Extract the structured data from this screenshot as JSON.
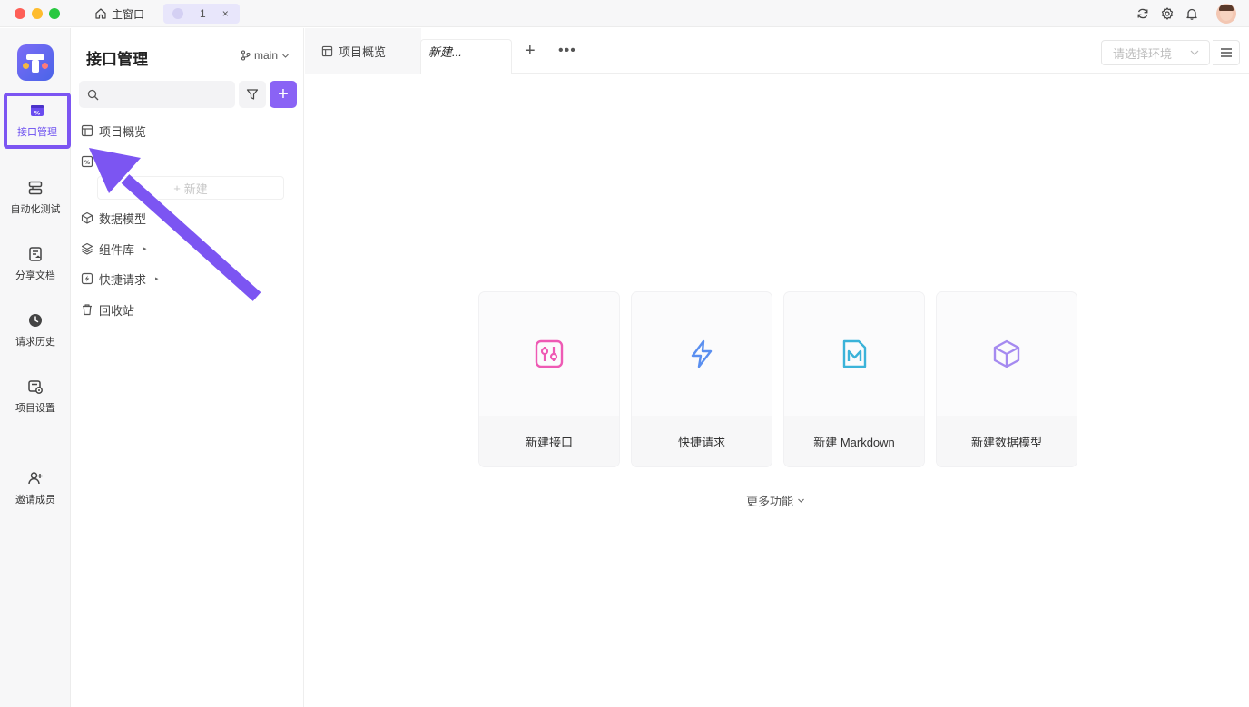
{
  "titlebar": {
    "home_tab_label": "主窗口",
    "project_tab_label": "1",
    "project_tab_close": "×"
  },
  "rail": {
    "items": [
      {
        "label": "接口管理",
        "icon": "api-icon",
        "active": true
      },
      {
        "label": "自动化测试",
        "icon": "automation-icon"
      },
      {
        "label": "分享文档",
        "icon": "share-doc-icon"
      },
      {
        "label": "请求历史",
        "icon": "history-icon"
      },
      {
        "label": "项目设置",
        "icon": "settings-icon"
      },
      {
        "label": "邀请成员",
        "icon": "invite-user-icon"
      }
    ]
  },
  "sidebar": {
    "title": "接口管理",
    "branch": "main",
    "search_placeholder": "",
    "tree": [
      {
        "label": "项目概览",
        "icon": "overview-icon"
      },
      {
        "label": "",
        "icon": "api-icon"
      },
      {
        "label": "数据模型",
        "icon": "cube-icon"
      },
      {
        "label": "组件库",
        "icon": "layers-icon",
        "caret": "▸"
      },
      {
        "label": "快捷请求",
        "icon": "quick-request-icon",
        "caret": "▸"
      },
      {
        "label": "回收站",
        "icon": "trash-icon"
      }
    ],
    "new_label": "新建"
  },
  "tabs": {
    "items": [
      {
        "label": "项目概览"
      },
      {
        "label": "新建..."
      }
    ],
    "env_placeholder": "请选择环境"
  },
  "main": {
    "cards": [
      {
        "label": "新建接口",
        "icon": "api-icon",
        "color": "#ee5ab4"
      },
      {
        "label": "快捷请求",
        "icon": "lightning-icon",
        "color": "#5a8ff0"
      },
      {
        "label": "新建 Markdown",
        "icon": "markdown-icon",
        "color": "#3bb3d9"
      },
      {
        "label": "新建数据模型",
        "icon": "cube-icon",
        "color": "#a58af0"
      }
    ],
    "more_label": "更多功能"
  },
  "colors": {
    "accent": "#8a63f5",
    "annotation": "#7c55f2"
  }
}
